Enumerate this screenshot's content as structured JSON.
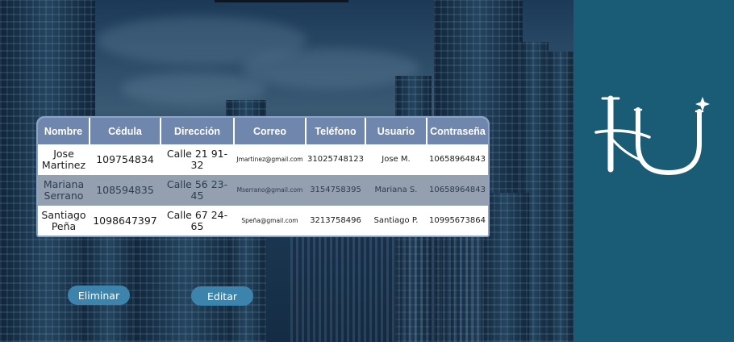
{
  "table": {
    "headers": [
      "Nombre",
      "Cédula",
      "Dirección",
      "Correo",
      "Teléfono",
      "Usuario",
      "Contraseña"
    ],
    "rows": [
      {
        "nombre": "Jose Martinez",
        "cedula": "109754834",
        "direccion": "Calle 21 91-32",
        "correo": "Jmartinez@gmail.com",
        "telefono": "31025748123",
        "usuario": "Jose M.",
        "contrasena": "10658964843",
        "selected": false
      },
      {
        "nombre": "Mariana Serrano",
        "cedula": "108594835",
        "direccion": "Calle 56 23-45",
        "correo": "Mserrano@gmail.com",
        "telefono": "3154758395",
        "usuario": "Mariana S.",
        "contrasena": "10658964843",
        "selected": true
      },
      {
        "nombre": "Santiago Peña",
        "cedula": "1098647397",
        "direccion": "Calle 67 24-65",
        "correo": "Speña@gmail.com",
        "telefono": "3213758496",
        "usuario": "Santiago P.",
        "contrasena": "10995673864",
        "selected": false
      }
    ]
  },
  "buttons": {
    "delete_label": "Eliminar",
    "edit_label": "Editar"
  },
  "colors": {
    "side_panel": "#1a5b75",
    "header_bg": "#6f86ad",
    "button_bg": "#3d84ad",
    "selected_row": "#7d8a9e"
  },
  "icons": {
    "logo": "hu-logo"
  }
}
